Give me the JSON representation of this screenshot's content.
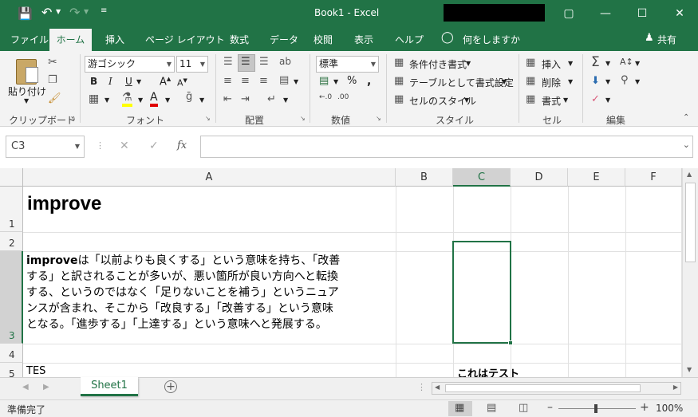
{
  "titlebar": {
    "title": "Book1  -  Excel"
  },
  "tabs": [
    "ファイル",
    "ホーム",
    "挿入",
    "ページ レイアウト",
    "数式",
    "データ",
    "校閲",
    "表示",
    "ヘルプ",
    "何をしますか"
  ],
  "share_label": "共有",
  "ribbon": {
    "clipboard": {
      "paste": "貼り付け",
      "label": "クリップボード"
    },
    "font": {
      "name": "游ゴシック",
      "size": "11",
      "label": "フォント"
    },
    "align": {
      "label": "配置"
    },
    "number": {
      "format": "標準",
      "label": "数値"
    },
    "styles": {
      "cond": "条件付き書式",
      "table": "テーブルとして書式設定",
      "cell": "セルのスタイル",
      "label": "スタイル"
    },
    "cells": {
      "insert": "挿入",
      "delete": "削除",
      "format": "書式",
      "label": "セル"
    },
    "edit": {
      "label": "編集"
    }
  },
  "formula": {
    "namebox": "C3",
    "fx": "fx",
    "value": ""
  },
  "columns": [
    "A",
    "B",
    "C",
    "D",
    "E",
    "F"
  ],
  "rows": [
    "1",
    "2",
    "3",
    "4",
    "5"
  ],
  "cells": {
    "A1": "improve",
    "A3_bold": "improve",
    "A3_line1": "は「以前よりも良くする」という意味を持ち、「改善",
    "A3_line2": "する」と訳されることが多いが、悪い箇所が良い方向へと転換",
    "A3_line3": "する、というのではなく「足りないことを補う」というニュア",
    "A3_line4": "ンスが含まれ、そこから「改良する」「改善する」という意味",
    "A3_line5": "となる。「進歩する」「上達する」という意味へと発展する。",
    "A5": "TES",
    "C5": "これはテスト"
  },
  "sheet": {
    "name": "Sheet1"
  },
  "status": {
    "ready": "準備完了",
    "zoom": "100%"
  },
  "colors": {
    "excel_green": "#217346",
    "selection": "#217346"
  }
}
